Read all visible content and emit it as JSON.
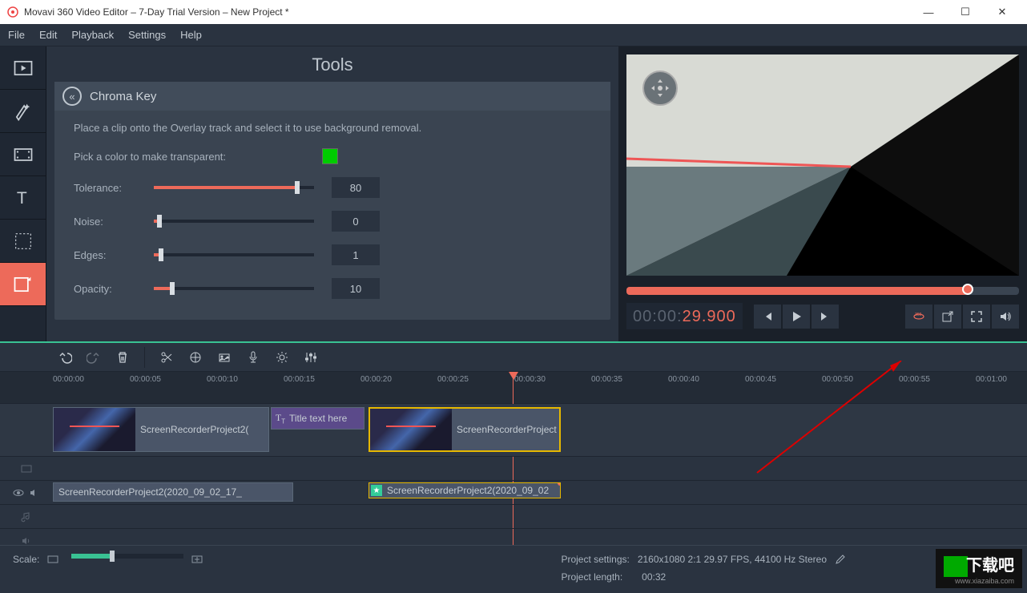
{
  "window": {
    "title": "Movavi 360 Video Editor – 7-Day Trial Version – New Project *"
  },
  "menu": [
    "File",
    "Edit",
    "Playback",
    "Settings",
    "Help"
  ],
  "left_tools": [
    {
      "name": "media-icon"
    },
    {
      "name": "filters-icon"
    },
    {
      "name": "transitions-icon"
    },
    {
      "name": "titles-icon"
    },
    {
      "name": "stickers-icon"
    },
    {
      "name": "chroma-icon"
    }
  ],
  "tools": {
    "title": "Tools",
    "panel_name": "Chroma Key",
    "description": "Place a clip onto the Overlay track and select it to use background removal.",
    "color_label": "Pick a color to make transparent:",
    "color_value": "#00cc00",
    "sliders": [
      {
        "label": "Tolerance:",
        "value": "80",
        "pct": 88
      },
      {
        "label": "Noise:",
        "value": "0",
        "pct": 2
      },
      {
        "label": "Edges:",
        "value": "1",
        "pct": 3
      },
      {
        "label": "Opacity:",
        "value": "10",
        "pct": 10
      }
    ]
  },
  "preview": {
    "timecode_gray": "00:00:",
    "timecode_highlight": "29.900"
  },
  "ruler_marks": [
    "00:00:00",
    "00:00:05",
    "00:00:10",
    "00:00:15",
    "00:00:20",
    "00:00:25",
    "00:00:30",
    "00:00:35",
    "00:00:40",
    "00:00:45",
    "00:00:50",
    "00:00:55",
    "00:01:00"
  ],
  "clips": {
    "overlay_1": "ScreenRecorderProject2(",
    "overlay_2": "ScreenRecorderProject",
    "title": "Title text here",
    "main_video": "ScreenRecorderProject2(2020_09_02_17_",
    "main_audio": "ScreenRecorderProject2(2020_09_02"
  },
  "status": {
    "scale_label": "Scale:",
    "settings_label": "Project settings:",
    "settings_value": "2160x1080 2:1 29.97 FPS, 44100 Hz Stereo",
    "length_label": "Project length:",
    "length_value": "00:32"
  },
  "watermark": "下载吧",
  "watermark_url": "www.xiazaiba.com"
}
